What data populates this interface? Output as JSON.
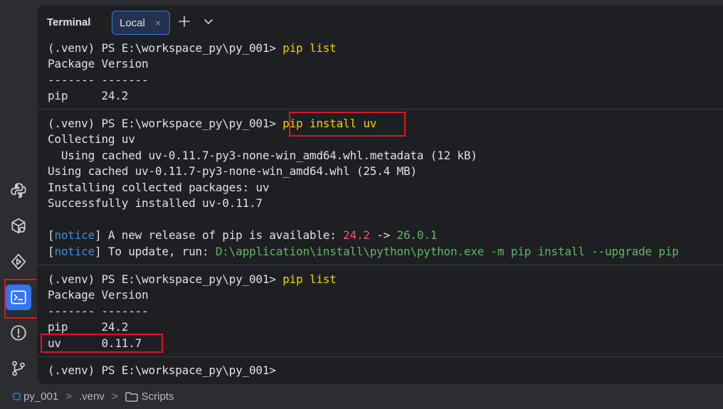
{
  "header": {
    "title": "Terminal",
    "tab_label": "Local",
    "tab_close": "×"
  },
  "terminal": {
    "block1": {
      "prompt": "(.venv) PS E:\\workspace_py\\py_001> ",
      "command": "pip list",
      "lines": [
        "Package Version",
        "------- -------",
        "pip     24.2"
      ]
    },
    "block2": {
      "prompt": "(.venv) PS E:\\workspace_py\\py_001> ",
      "command": "pip install uv",
      "lines": [
        "Collecting uv",
        "  Using cached uv-0.11.7-py3-none-win_amd64.whl.metadata (12 kB)",
        "Using cached uv-0.11.7-py3-none-win_amd64.whl (25.4 MB)",
        "Installing collected packages: uv",
        "Successfully installed uv-0.11.7"
      ],
      "notice1": {
        "lb": "[",
        "tag": "notice",
        "rb": "]",
        "text": " A new release of pip is available: ",
        "old": "24.2",
        "arrow": " -> ",
        "new": "26.0.1"
      },
      "notice2": {
        "lb": "[",
        "tag": "notice",
        "rb": "]",
        "text": " To update, run: ",
        "cmd": "D:\\application\\install\\python\\python.exe -m pip install --upgrade pip"
      }
    },
    "block3": {
      "prompt": "(.venv) PS E:\\workspace_py\\py_001> ",
      "command": "pip list",
      "lines": [
        "Package Version",
        "------- -------",
        "pip     24.2",
        "uv      0.11.7"
      ]
    },
    "block4": {
      "prompt": "(.venv) PS E:\\workspace_py\\py_001>"
    }
  },
  "toolstrip": {
    "icons": [
      "python-packages-icon",
      "services-icon",
      "run-icon",
      "terminal-icon",
      "problems-icon",
      "git-icon"
    ],
    "active": "terminal-icon"
  },
  "statusbar": {
    "project": "py_001",
    "sep1": ">",
    "venv": ".venv",
    "sep2": ">",
    "folder": "Scripts"
  },
  "colors": {
    "accent": "#3574f0",
    "highlight": "#e0141e",
    "command": "#f0d000",
    "notice": "#3d8ce0",
    "old_version": "#f75464",
    "new_version": "#5fb865"
  }
}
